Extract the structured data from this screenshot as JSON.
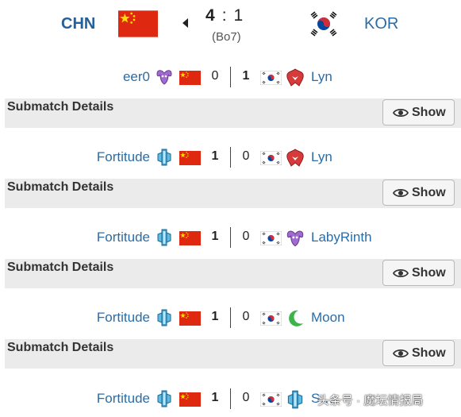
{
  "header": {
    "team_left": "CHN",
    "team_right": "KOR",
    "score_left": "4",
    "score_sep": ":",
    "score_right": "1",
    "format": "(Bo7)"
  },
  "details_label": "Submatch Details",
  "show_label": "Show",
  "matches": [
    {
      "left_player": "eer0",
      "left_race": "zerg",
      "left_score": "0",
      "right_score": "1",
      "right_race": "protoss",
      "right_player": "Lyn",
      "winner": "right"
    },
    {
      "left_player": "Fortitude",
      "left_race": "terran",
      "left_score": "1",
      "right_score": "0",
      "right_race": "protoss",
      "right_player": "Lyn",
      "winner": "left"
    },
    {
      "left_player": "Fortitude",
      "left_race": "terran",
      "left_score": "1",
      "right_score": "0",
      "right_race": "zerg",
      "right_player": "LabyRinth",
      "winner": "left"
    },
    {
      "left_player": "Fortitude",
      "left_race": "terran",
      "left_score": "1",
      "right_score": "0",
      "right_race": "night-elf",
      "right_player": "Moon",
      "winner": "left"
    },
    {
      "left_player": "Fortitude",
      "left_race": "terran",
      "left_score": "1",
      "right_score": "0",
      "right_race": "terran",
      "right_player": "S…",
      "winner": "left"
    }
  ],
  "watermark": "头条号 · 魔坛情报局",
  "colors": {
    "team_blue": "#24609a",
    "player_blue": "#2a6ca8",
    "details_bg": "#ebebeb",
    "china_red": "#de2910",
    "china_yellow": "#ffde00",
    "korea_red": "#cd2e3a",
    "korea_blue": "#0047a0"
  }
}
